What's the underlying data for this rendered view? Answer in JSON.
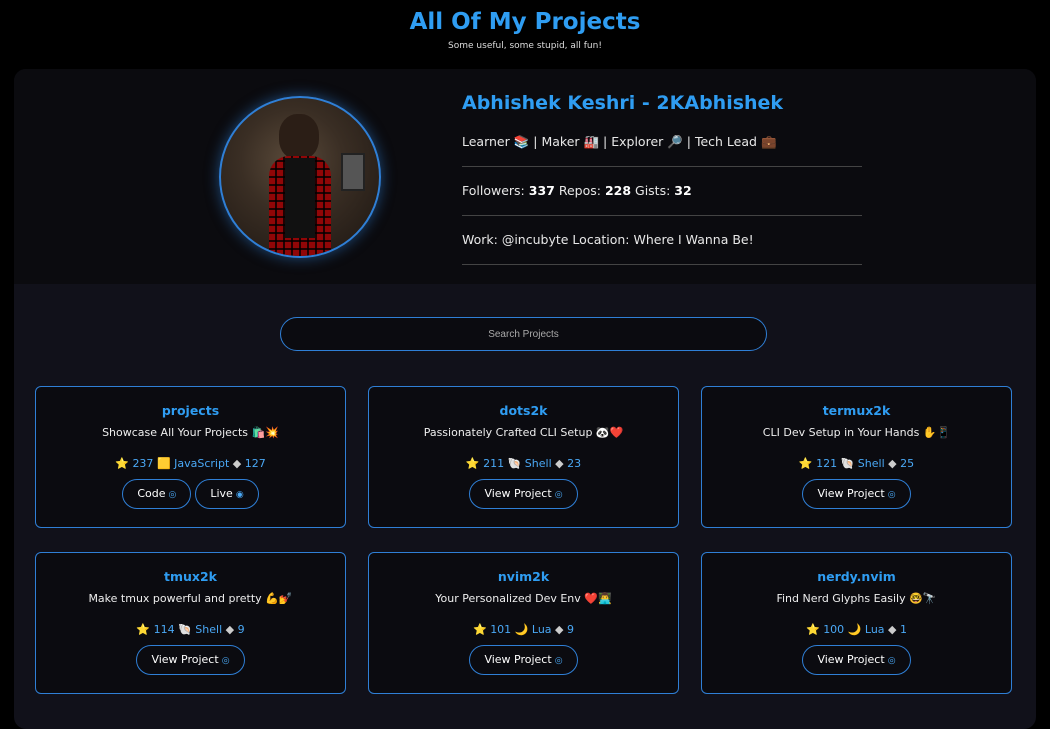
{
  "header": {
    "title": "All Of My Projects",
    "subtitle": "Some useful, some stupid, all fun!"
  },
  "profile": {
    "name": "Abhishek Keshri - 2KAbhishek",
    "tagline": "Learner 📚 | Maker 🏭 | Explorer 🔎 | Tech Lead 💼",
    "followers_label": "Followers:",
    "followers": "337",
    "repos_label": "Repos:",
    "repos": "228",
    "gists_label": "Gists:",
    "gists": "32",
    "work_line": "Work: @incubyte Location: Where I Wanna Be!"
  },
  "search": {
    "placeholder": "Search Projects"
  },
  "projects": [
    {
      "name": "projects",
      "desc": "Showcase All Your Projects 🛍️💥",
      "stars": "237",
      "lang_icon": "🟨",
      "lang": "JavaScript",
      "forks": "127",
      "buttons": [
        "Code",
        "Live"
      ]
    },
    {
      "name": "dots2k",
      "desc": "Passionately Crafted CLI Setup 🐼❤️",
      "stars": "211",
      "lang_icon": "🐚",
      "lang": "Shell",
      "forks": "23",
      "buttons": [
        "View Project"
      ]
    },
    {
      "name": "termux2k",
      "desc": "CLI Dev Setup in Your Hands ✋📱",
      "stars": "121",
      "lang_icon": "🐚",
      "lang": "Shell",
      "forks": "25",
      "buttons": [
        "View Project"
      ]
    },
    {
      "name": "tmux2k",
      "desc": "Make tmux powerful and pretty 💪💅",
      "stars": "114",
      "lang_icon": "🐚",
      "lang": "Shell",
      "forks": "9",
      "buttons": [
        "View Project"
      ]
    },
    {
      "name": "nvim2k",
      "desc": "Your Personalized Dev Env ❤️👨‍💻",
      "stars": "101",
      "lang_icon": "🌙",
      "lang": "Lua",
      "forks": "9",
      "buttons": [
        "View Project"
      ]
    },
    {
      "name": "nerdy.nvim",
      "desc": "Find Nerd Glyphs Easily 🤓🔭",
      "stars": "100",
      "lang_icon": "🌙",
      "lang": "Lua",
      "forks": "1",
      "buttons": [
        "View Project"
      ]
    }
  ],
  "icons": {
    "star": "⭐",
    "fork": "🍴",
    "github": "github-icon",
    "globe": "globe-icon"
  },
  "colors": {
    "accent": "#2f9df2",
    "border": "#2f7fd6",
    "bg": "#000000"
  }
}
